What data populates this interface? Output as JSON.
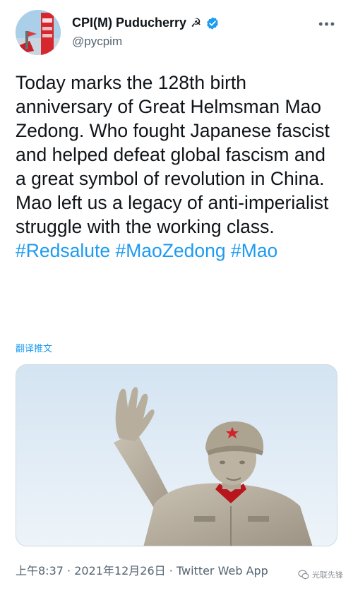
{
  "tweet": {
    "display_name": "CPI(M) Puducherry",
    "name_emoji": "☭",
    "handle": "@pycpim",
    "more_label": "•••",
    "text_segments": [
      {
        "text": "Today marks the 128th birth anniversary of Great Helmsman Mao Zedong. Who fought Japanese fascist  and helped defeat global fascism and a great symbol of revolution in China. Mao left us a legacy of anti-imperialist struggle with the working class. "
      },
      {
        "hashtag": "#Redsalute"
      },
      {
        "text": " "
      },
      {
        "hashtag": "#MaoZedong"
      },
      {
        "text": " "
      },
      {
        "hashtag": "#Mao"
      }
    ],
    "translate_label": "翻译推文",
    "timestamp": "上午8:37 · 2021年12月26日 · Twitter Web App"
  },
  "watermark": {
    "label": "光联先锋"
  },
  "colors": {
    "accent": "#1d9bf0",
    "text": "#0f1419",
    "muted": "#536471"
  }
}
